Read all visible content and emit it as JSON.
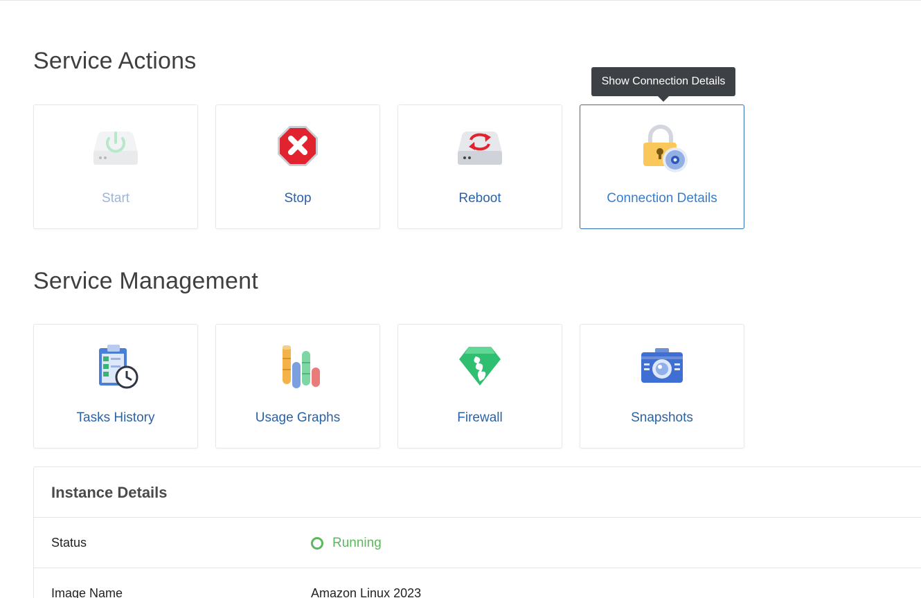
{
  "sections": {
    "actions_title": "Service Actions",
    "management_title": "Service Management"
  },
  "actions": [
    {
      "label": "Start",
      "icon": "power-drive-icon",
      "state": "disabled"
    },
    {
      "label": "Stop",
      "icon": "stop-octagon-icon",
      "state": "enabled"
    },
    {
      "label": "Reboot",
      "icon": "reboot-drive-icon",
      "state": "enabled"
    },
    {
      "label": "Connection Details",
      "icon": "padlock-gear-icon",
      "state": "hovered"
    }
  ],
  "tooltip": "Show Connection Details",
  "management": [
    {
      "label": "Tasks History",
      "icon": "clipboard-clock-icon"
    },
    {
      "label": "Usage Graphs",
      "icon": "bar-cylinders-icon"
    },
    {
      "label": "Firewall",
      "icon": "firewall-gem-icon"
    },
    {
      "label": "Snapshots",
      "icon": "camera-icon"
    }
  ],
  "instance": {
    "title": "Instance Details",
    "rows": [
      {
        "key": "Status",
        "value": "Running"
      },
      {
        "key": "Image Name",
        "value": "Amazon Linux 2023"
      }
    ]
  },
  "colors": {
    "link": "#2a62a8",
    "active_border": "#2b6fb8",
    "running": "#5cb85c",
    "tooltip_bg": "#3d4045"
  }
}
